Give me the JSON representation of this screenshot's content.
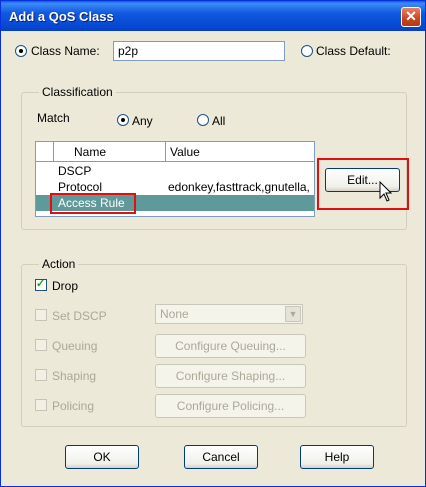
{
  "window": {
    "title": "Add a QoS Class"
  },
  "class_name": {
    "label": "Class Name:",
    "value": "p2p",
    "selected": true
  },
  "class_default": {
    "label": "Class Default:",
    "selected": false
  },
  "classification": {
    "title": "Classification",
    "match_label": "Match",
    "match_any": {
      "label": "Any",
      "selected": true
    },
    "match_all": {
      "label": "All",
      "selected": false
    },
    "table": {
      "columns": [
        "Name",
        "Value"
      ],
      "rows": [
        {
          "name": "DSCP",
          "value": ""
        },
        {
          "name": "Protocol",
          "value": "edonkey,fasttrack,gnutella,"
        },
        {
          "name": "Access Rule",
          "value": "",
          "selected": true
        }
      ]
    },
    "edit_button": "Edit..."
  },
  "action": {
    "title": "Action",
    "drop": {
      "label": "Drop",
      "checked": true
    },
    "set_dscp": {
      "label": "Set DSCP",
      "checked": false,
      "dropdown_value": "None"
    },
    "queuing": {
      "label": "Queuing",
      "checked": false,
      "button": "Configure Queuing..."
    },
    "shaping": {
      "label": "Shaping",
      "checked": false,
      "button": "Configure Shaping..."
    },
    "policing": {
      "label": "Policing",
      "checked": false,
      "button": "Configure Policing..."
    }
  },
  "buttons": {
    "ok": "OK",
    "cancel": "Cancel",
    "help": "Help"
  },
  "colors": {
    "titlebar": "#0546d2",
    "selection": "#5f9999",
    "highlight_box": "#e01010",
    "face": "#ece9d8"
  }
}
